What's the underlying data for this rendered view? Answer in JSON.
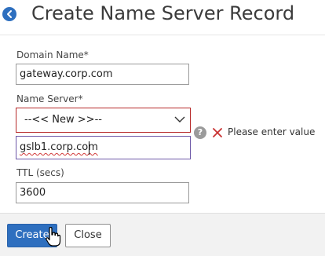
{
  "header": {
    "title": "Create Name Server Record",
    "back_icon": "back-arrow-icon"
  },
  "form": {
    "domain_name": {
      "label": "Domain Name*",
      "value": "gateway.corp.com"
    },
    "name_server": {
      "label": "Name Server*",
      "selected": "--<< New >>--",
      "entry_value": "gslb1.corp.com",
      "help_icon": "question-icon",
      "error_icon": "error-x-icon",
      "error_text": "Please enter value"
    },
    "ttl": {
      "label": "TTL (secs)",
      "value": "3600"
    }
  },
  "footer": {
    "create_label": "Create",
    "close_label": "Close"
  },
  "colors": {
    "primary": "#2e6fbf",
    "error": "#b72a2a",
    "focus": "#6d58a8"
  }
}
